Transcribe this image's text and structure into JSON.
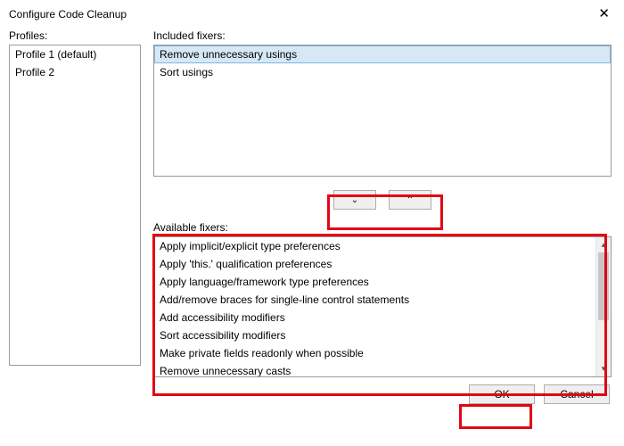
{
  "window": {
    "title": "Configure Code Cleanup",
    "close_glyph": "✕"
  },
  "labels": {
    "profiles": "Profiles:",
    "included": "Included fixers:",
    "available": "Available fixers:"
  },
  "profiles": [
    {
      "label": "Profile 1 (default)"
    },
    {
      "label": "Profile 2"
    }
  ],
  "included_fixers": [
    {
      "label": "Remove unnecessary usings",
      "selected": true
    },
    {
      "label": "Sort usings",
      "selected": false
    }
  ],
  "arrows": {
    "down_glyph": "⌄",
    "up_glyph": "⌃"
  },
  "available_fixers": [
    {
      "label": "Apply implicit/explicit type preferences"
    },
    {
      "label": "Apply 'this.' qualification preferences"
    },
    {
      "label": "Apply language/framework type preferences"
    },
    {
      "label": "Add/remove braces for single-line control statements"
    },
    {
      "label": "Add accessibility modifiers"
    },
    {
      "label": "Sort accessibility modifiers"
    },
    {
      "label": "Make private fields readonly when possible"
    },
    {
      "label": "Remove unnecessary casts"
    }
  ],
  "scrollbar": {
    "up_glyph": "▴",
    "down_glyph": "▾"
  },
  "buttons": {
    "ok": "OK",
    "cancel": "Cancel"
  }
}
